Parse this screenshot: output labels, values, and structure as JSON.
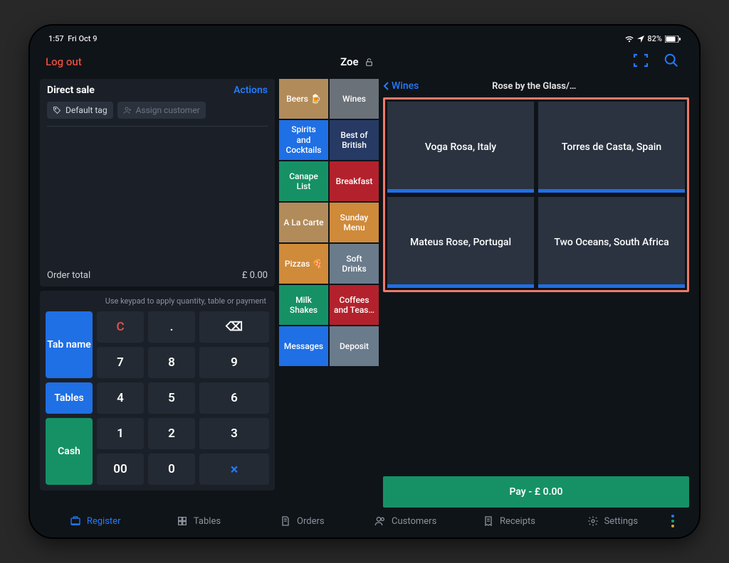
{
  "status": {
    "time": "1:57",
    "date": "Fri Oct 9",
    "battery": "82%"
  },
  "appbar": {
    "logout": "Log out",
    "user": "Zoe"
  },
  "sale": {
    "title": "Direct sale",
    "actions": "Actions",
    "default_tag": "Default tag",
    "assign_customer": "Assign customer",
    "order_total_label": "Order total",
    "order_total_value": "£ 0.00"
  },
  "keypad": {
    "hint": "Use keypad to apply quantity, table or payment",
    "clear": "C",
    "dot": ".",
    "back": "⌫",
    "k7": "7",
    "k8": "8",
    "k9": "9",
    "k4": "4",
    "k5": "5",
    "k6": "6",
    "k1": "1",
    "k2": "2",
    "k3": "3",
    "k00": "00",
    "k0": "0",
    "kx": "×",
    "tab_name": "Tab name",
    "tables": "Tables",
    "cash": "Cash"
  },
  "categories": {
    "beers": "Beers 🍺",
    "wines": "Wines",
    "spirits": "Spirits and Cocktails",
    "british": "Best of British",
    "canape": "Canape List",
    "breakfast": "Breakfast",
    "alacarte": "A La Carte",
    "sunday": "Sunday Menu",
    "pizzas": "Pizzas 🍕",
    "soft": "Soft Drinks",
    "milk": "Milk Shakes",
    "coffees": "Coffees and Teas…",
    "messages": "Messages",
    "deposit": "Deposit"
  },
  "crumb": {
    "back": "Wines",
    "title": "Rose by the Glass/…"
  },
  "products": {
    "p1": "Voga Rosa, Italy",
    "p2": "Torres de Casta, Spain",
    "p3": "Mateus Rose, Portugal",
    "p4": "Two Oceans, South Africa"
  },
  "pay": "Pay - £ 0.00",
  "nav": {
    "register": "Register",
    "tables": "Tables",
    "orders": "Orders",
    "customers": "Customers",
    "receipts": "Receipts",
    "settings": "Settings"
  }
}
